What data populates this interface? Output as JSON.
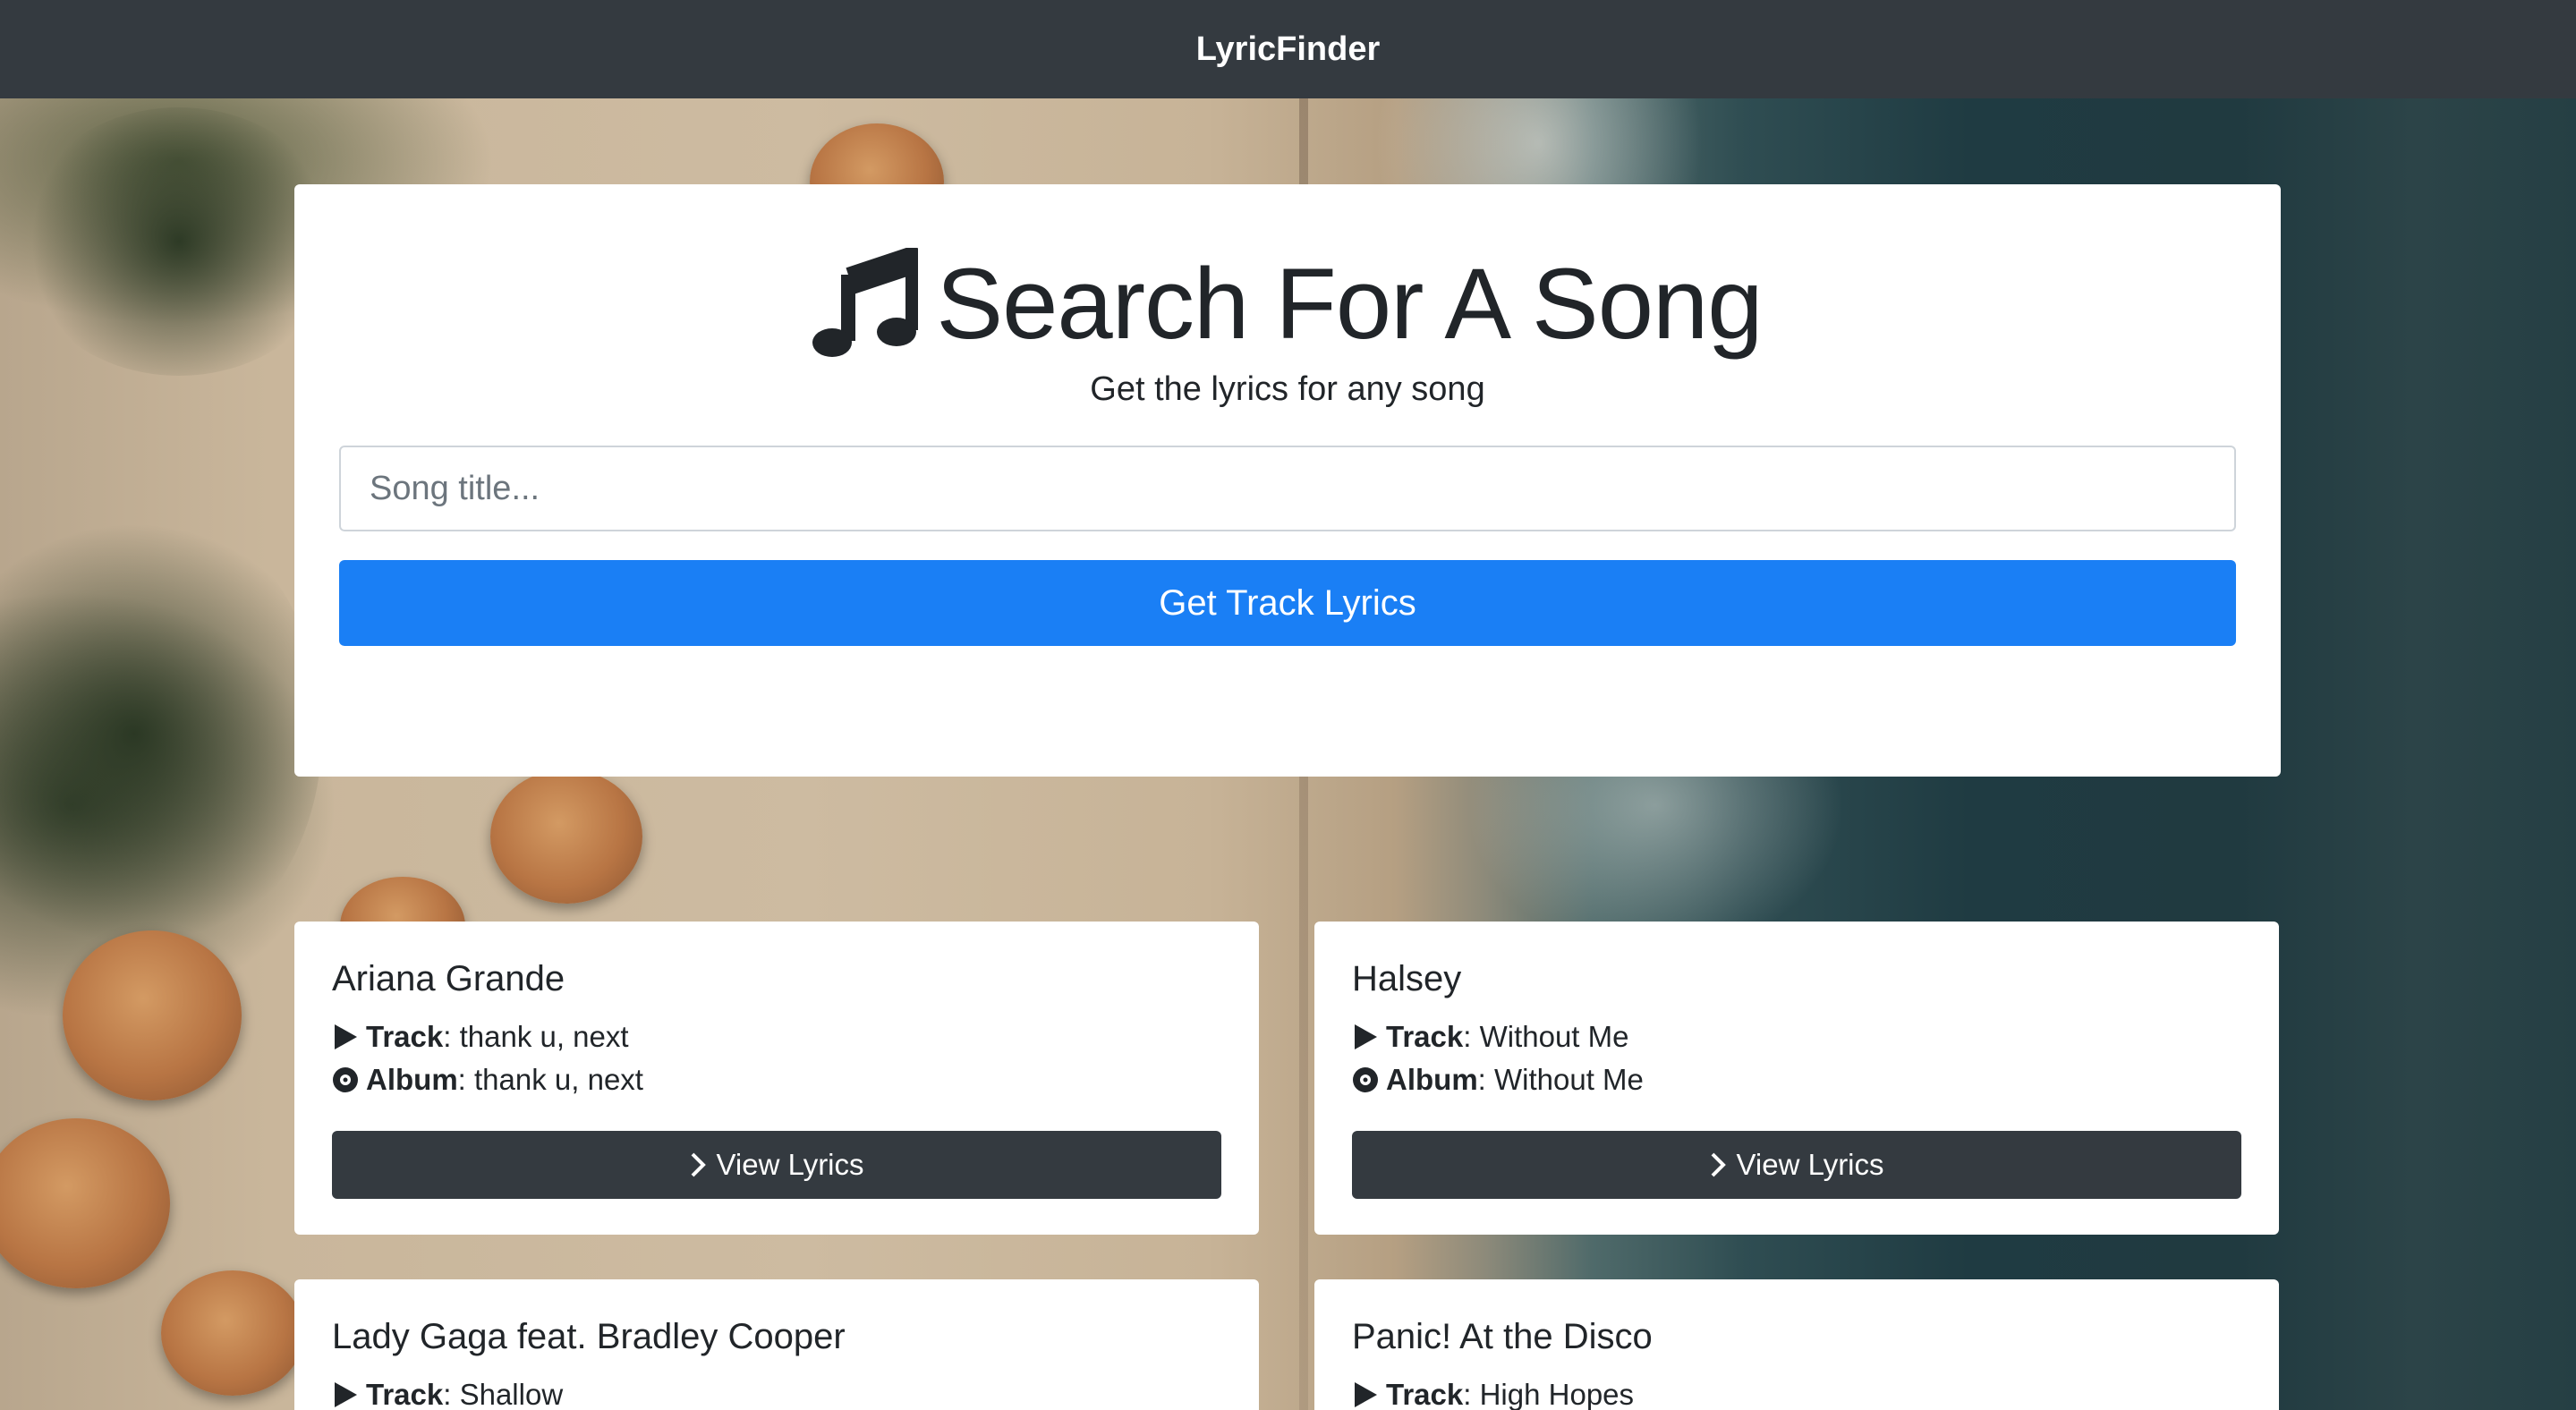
{
  "navbar": {
    "brand": "LyricFinder"
  },
  "search": {
    "title": "Search For A Song",
    "subtitle": "Get the lyrics for any song",
    "input_placeholder": "Song title...",
    "input_value": "",
    "button_label": "Get Track Lyrics"
  },
  "labels": {
    "track": "Track",
    "album": "Album",
    "view": "View Lyrics"
  },
  "tracks": [
    {
      "artist": "Ariana Grande",
      "track": "thank u, next",
      "album": "thank u, next"
    },
    {
      "artist": "Halsey",
      "track": "Without Me",
      "album": "Without Me"
    },
    {
      "artist": "Lady Gaga feat. Bradley Cooper",
      "track": "Shallow",
      "album": ""
    },
    {
      "artist": "Panic! At the Disco",
      "track": "High Hopes",
      "album": ""
    }
  ],
  "colors": {
    "navbar": "#343a40",
    "primary": "#1a7ff5",
    "dark_button": "#343a40",
    "text": "#212529"
  },
  "icons": {
    "title": "music-note-icon",
    "track": "play-icon",
    "album": "compact-disc-icon",
    "view": "chevron-right-icon"
  }
}
